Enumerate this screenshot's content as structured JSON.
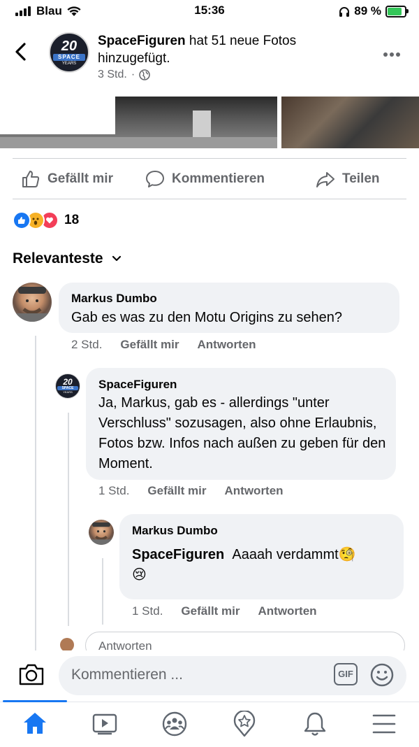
{
  "status_bar": {
    "carrier": "Blau",
    "time": "15:36",
    "battery": "89 %",
    "battery_level": 0.89,
    "signal_bars": 4
  },
  "header": {
    "poster": "SpaceFiguren",
    "action": " hat 51 neue Fotos hinzugefügt.",
    "time": "3 Std.",
    "separator": "·",
    "logo": {
      "number": "20",
      "band": "SPACE",
      "bottom": "YEARS"
    }
  },
  "actions": {
    "like": "Gefällt mir",
    "comment": "Kommentieren",
    "share": "Teilen"
  },
  "reactions": {
    "count": "18",
    "types": [
      "like-icon",
      "wow-icon",
      "love-icon"
    ],
    "colors": {
      "like": "#1877f2",
      "wow": "#f7b125",
      "love": "#f33e58"
    }
  },
  "sort": {
    "label": "Relevanteste"
  },
  "comments": [
    {
      "author": "Markus Dumbo",
      "text": "Gab es was zu den Motu Origins zu sehen?",
      "time": "2 Std.",
      "like": "Gefällt mir",
      "reply": "Antworten"
    },
    {
      "author": "SpaceFiguren",
      "text": "Ja, Markus, gab es - allerdings \"unter Verschluss\" sozusagen, also ohne Erlaubnis, Fotos bzw. Infos nach außen zu geben für den Moment.",
      "time": "1 Std.",
      "like": "Gefällt mir",
      "reply": "Antworten"
    },
    {
      "author": "Markus Dumbo",
      "mention": "SpaceFiguren",
      "text": "Aaaah verdammt",
      "emoji1": "🧐",
      "emoji2": "😢",
      "time": "1 Std.",
      "like": "Gefällt mir",
      "reply": "Antworten"
    }
  ],
  "reply_input": {
    "placeholder": "Antworten"
  },
  "comment_bar": {
    "placeholder": "Kommentieren ...",
    "gif": "GIF"
  },
  "colors": {
    "accent": "#1877f2",
    "muted": "#65676b",
    "bubble": "#f0f2f5"
  }
}
